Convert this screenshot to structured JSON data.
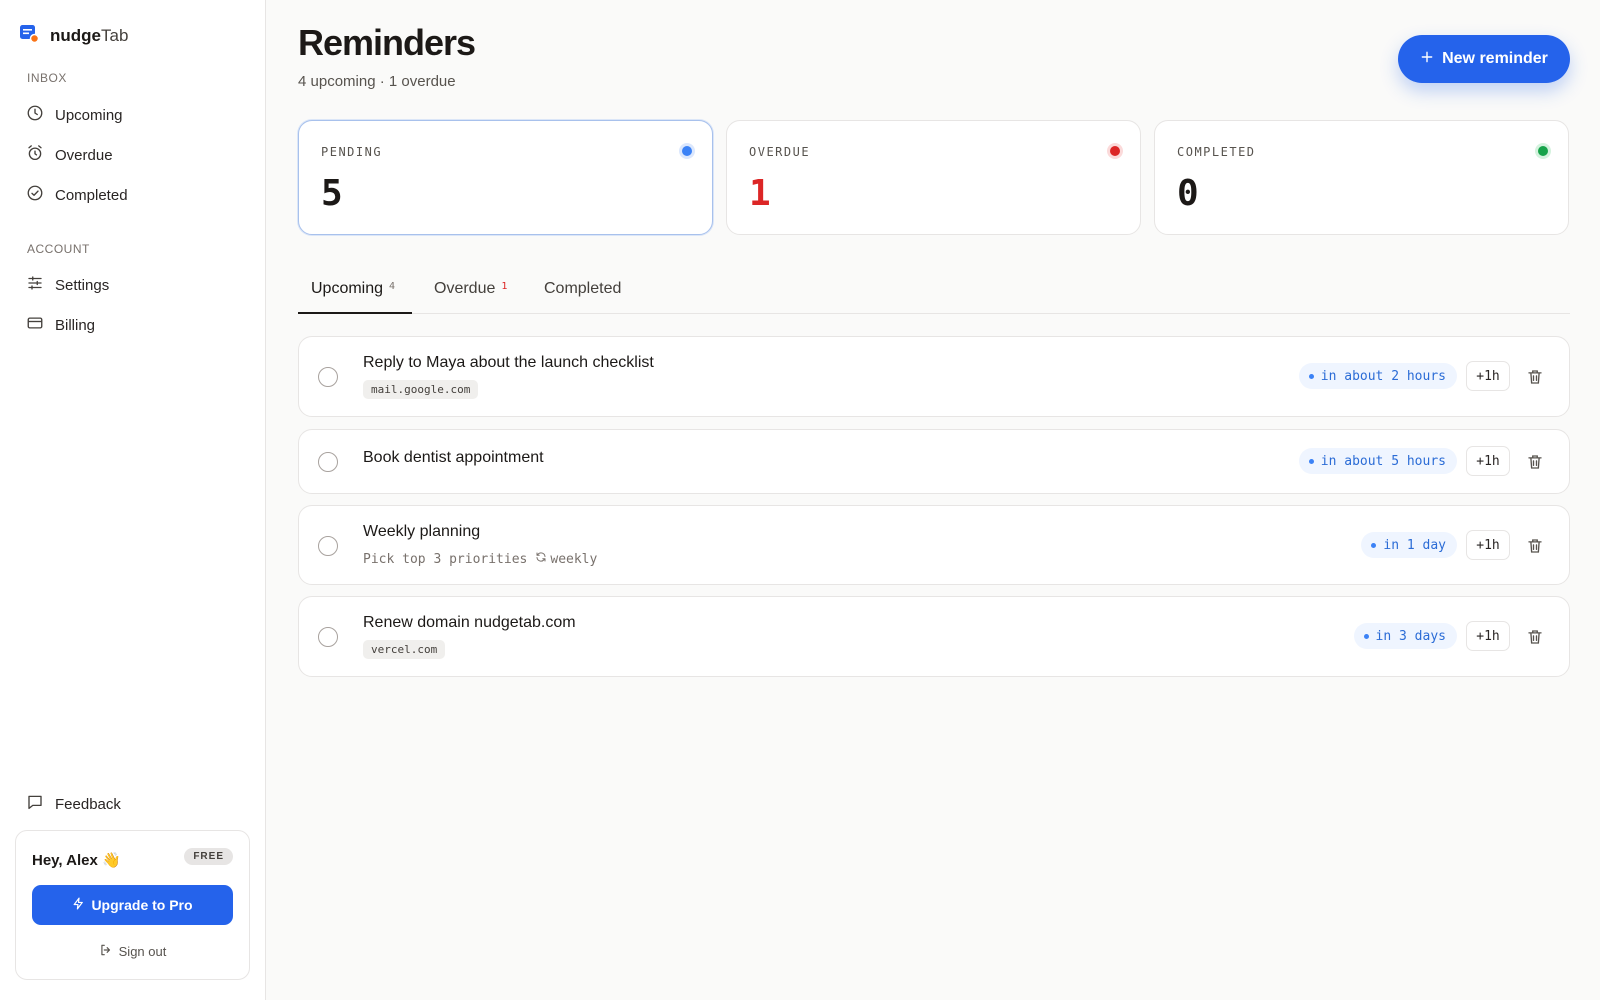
{
  "brand": {
    "name_bold": "nudge",
    "name_light": "Tab",
    "icon": "nudgetab-logo-icon"
  },
  "sidebar": {
    "inbox_label": "INBOX",
    "inbox_items": [
      {
        "label": "Upcoming",
        "icon": "clock-icon"
      },
      {
        "label": "Overdue",
        "icon": "alarm-icon"
      },
      {
        "label": "Completed",
        "icon": "check-circle-icon"
      }
    ],
    "account_label": "ACCOUNT",
    "account_items": [
      {
        "label": "Settings",
        "icon": "sliders-icon"
      },
      {
        "label": "Billing",
        "icon": "credit-card-icon"
      }
    ],
    "feedback": "Feedback",
    "user": {
      "greeting": "Hey, Alex 👋",
      "plan": "FREE",
      "upgrade": "Upgrade to Pro",
      "signout": "Sign out"
    }
  },
  "header": {
    "title": "Reminders",
    "subtitle": "4 upcoming · 1 overdue",
    "new_button": "New reminder"
  },
  "stats": [
    {
      "label": "PENDING",
      "value": "5",
      "color": "#3b82f6",
      "value_color": "#1c1917"
    },
    {
      "label": "OVERDUE",
      "value": "1",
      "color": "#dc2626",
      "value_color": "#dc2626"
    },
    {
      "label": "COMPLETED",
      "value": "0",
      "color": "#16a34a",
      "value_color": "#1c1917"
    }
  ],
  "tabs": [
    {
      "label": "Upcoming",
      "count": "4"
    },
    {
      "label": "Overdue",
      "count": "1"
    },
    {
      "label": "Completed",
      "count": ""
    }
  ],
  "reminders": [
    {
      "title": "Reply to Maya about the launch checklist",
      "source": "mail.google.com",
      "due": "in about 2 hours",
      "snooze": "+1h"
    },
    {
      "title": "Book dentist appointment",
      "due": "in about 5 hours",
      "snooze": "+1h"
    },
    {
      "title": "Weekly planning",
      "note": "Pick top 3 priorities",
      "repeat": "weekly",
      "due": "in 1 day",
      "snooze": "+1h"
    },
    {
      "title": "Renew domain nudgetab.com",
      "source": "vercel.com",
      "due": "in 3 days",
      "snooze": "+1h"
    }
  ]
}
